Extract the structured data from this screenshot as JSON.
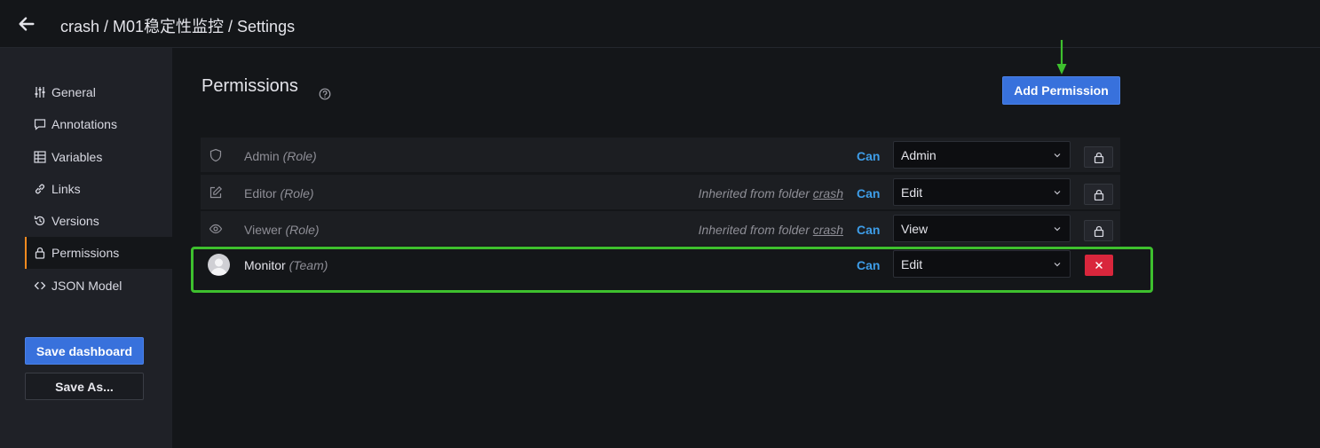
{
  "header": {
    "breadcrumb": "crash / M01稳定性监控 / Settings"
  },
  "sidebar": {
    "items": [
      {
        "label": "General",
        "icon": "sliders-icon"
      },
      {
        "label": "Annotations",
        "icon": "comment-icon"
      },
      {
        "label": "Variables",
        "icon": "table-icon"
      },
      {
        "label": "Links",
        "icon": "link-icon"
      },
      {
        "label": "Versions",
        "icon": "history-icon"
      },
      {
        "label": "Permissions",
        "icon": "lock-icon",
        "active": true
      },
      {
        "label": "JSON Model",
        "icon": "code-icon"
      }
    ],
    "save_dashboard_label": "Save dashboard",
    "save_as_label": "Save As..."
  },
  "main": {
    "title": "Permissions",
    "add_permission_label": "Add Permission",
    "rows": [
      {
        "name": "Admin",
        "type": "(Role)",
        "inherited_prefix": "",
        "inherited_folder": "",
        "can": "Can",
        "permission": "Admin",
        "icon": "shield-icon"
      },
      {
        "name": "Editor",
        "type": "(Role)",
        "inherited_prefix": "Inherited from folder",
        "inherited_folder": "crash",
        "can": "Can",
        "permission": "Edit",
        "icon": "edit-icon"
      },
      {
        "name": "Viewer",
        "type": "(Role)",
        "inherited_prefix": "Inherited from folder",
        "inherited_folder": "crash",
        "can": "Can",
        "permission": "View",
        "icon": "eye-icon"
      },
      {
        "name": "Monitor",
        "type": "(Team)",
        "inherited_prefix": "",
        "inherited_folder": "",
        "can": "Can",
        "permission": "Edit",
        "icon": "avatar"
      }
    ]
  },
  "colors": {
    "accent_blue": "#3871dc",
    "can_blue": "#3e9de8",
    "danger": "#d9263c",
    "annotation_green": "#3ec02e",
    "active_nav": "#f58a1f"
  }
}
